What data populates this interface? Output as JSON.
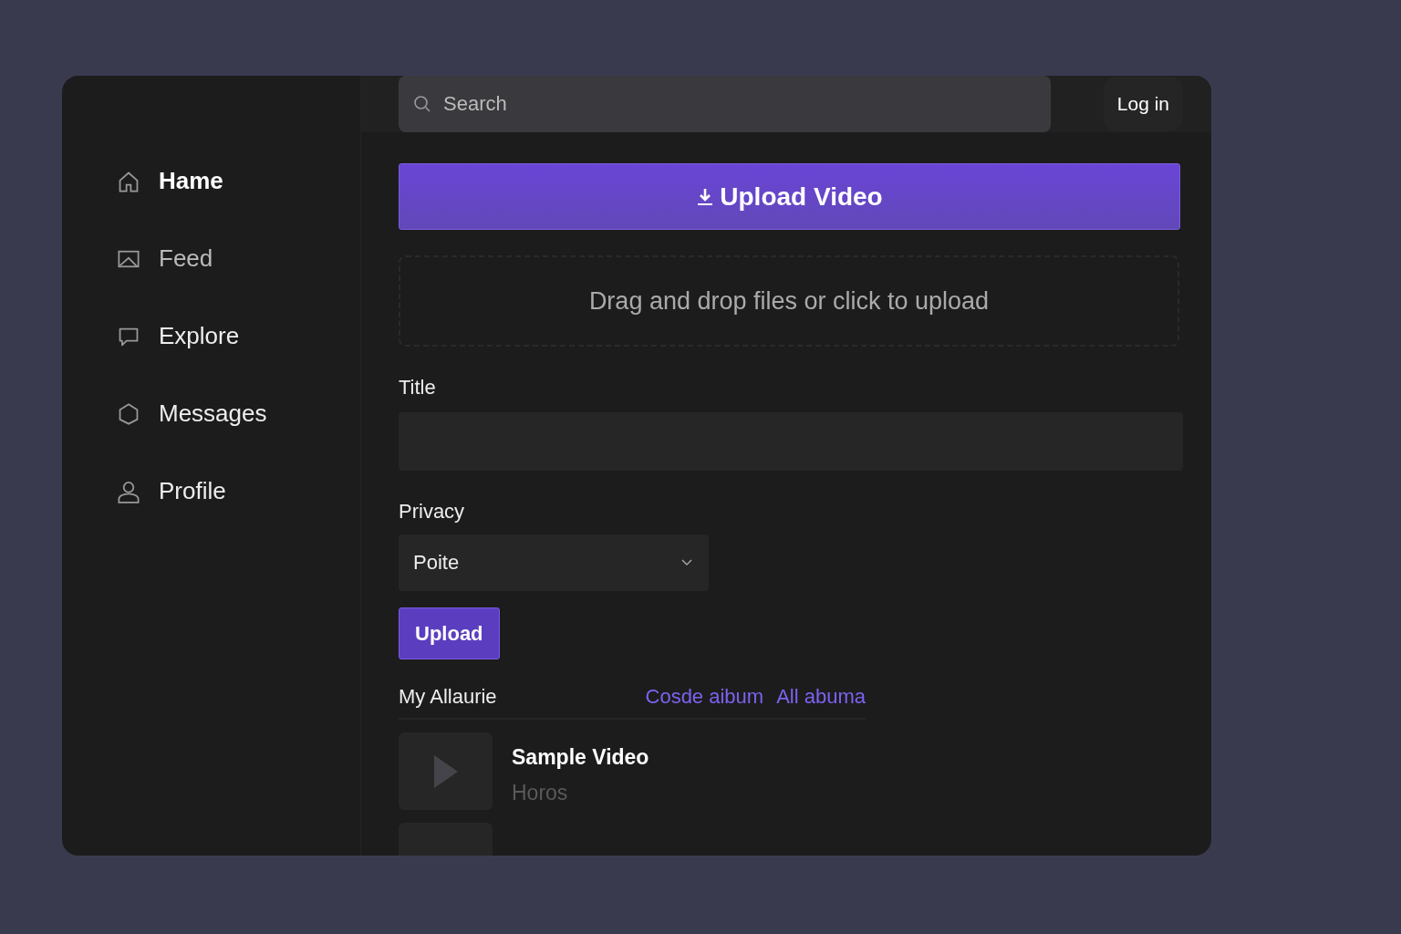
{
  "sidebar": {
    "items": [
      {
        "label": "Hame",
        "kind": "home",
        "selected": true,
        "muted": false
      },
      {
        "label": "Feed",
        "kind": "image",
        "selected": false,
        "muted": true
      },
      {
        "label": "Explore",
        "kind": "chat",
        "selected": false,
        "muted": false
      },
      {
        "label": "Messages",
        "kind": "hexagon",
        "selected": false,
        "muted": false
      },
      {
        "label": "Profile",
        "kind": "person",
        "selected": false,
        "muted": false
      }
    ]
  },
  "topbar": {
    "search": {
      "placeholder": "Search"
    },
    "login": "Log in"
  },
  "upload_video_button": "Upload Video",
  "dropzone": "Drag and drop files or click to upload",
  "title_field": {
    "label": "Title"
  },
  "privacy": {
    "label": "Privacy",
    "value": "Poite"
  },
  "upload_button": "Upload",
  "albums": {
    "heading": "My Allaurie",
    "links": [
      "Cosde aibum",
      "All abuma"
    ]
  },
  "videos": [
    {
      "title": "Sample Video",
      "subtitle": "Horos"
    },
    {
      "kind": "cut"
    }
  ]
}
